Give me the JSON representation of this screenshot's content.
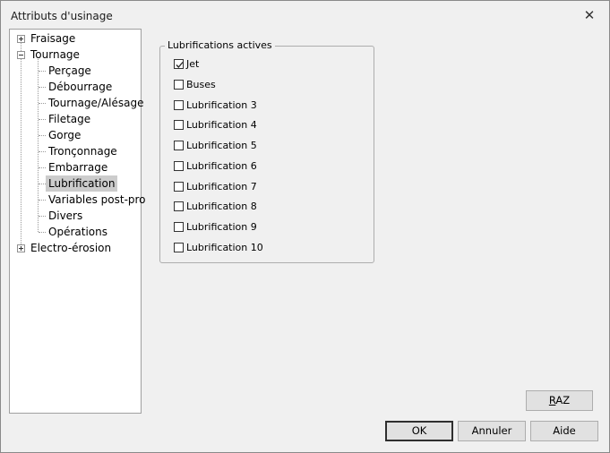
{
  "window": {
    "title": "Attributs d'usinage"
  },
  "tree": {
    "fraisage": "Fraisage",
    "tournage": "Tournage",
    "children": [
      "Perçage",
      "Débourrage",
      "Tournage/Alésage",
      "Filetage",
      "Gorge",
      "Tronçonnage",
      "Embarrage",
      "Lubrification",
      "Variables post-pro",
      "Divers",
      "Opérations"
    ],
    "electro": "Electro-érosion",
    "selected": "Lubrification"
  },
  "group": {
    "legend": "Lubrifications actives",
    "options": [
      {
        "label": "Jet",
        "checked": true
      },
      {
        "label": "Buses",
        "checked": false
      },
      {
        "label": "Lubrification 3",
        "checked": false
      },
      {
        "label": "Lubrification 4",
        "checked": false
      },
      {
        "label": "Lubrification 5",
        "checked": false
      },
      {
        "label": "Lubrification 6",
        "checked": false
      },
      {
        "label": "Lubrification 7",
        "checked": false
      },
      {
        "label": "Lubrification 8",
        "checked": false
      },
      {
        "label": "Lubrification 9",
        "checked": false
      },
      {
        "label": "Lubrification 10",
        "checked": false
      }
    ]
  },
  "buttons": {
    "raz_prefix": "R",
    "raz_rest": "AZ",
    "ok": "OK",
    "annuler": "Annuler",
    "aide": "Aide"
  },
  "icons": {
    "close": "close-icon",
    "expand": "plus-icon",
    "collapse": "minus-icon",
    "check": "checkmark-icon"
  }
}
